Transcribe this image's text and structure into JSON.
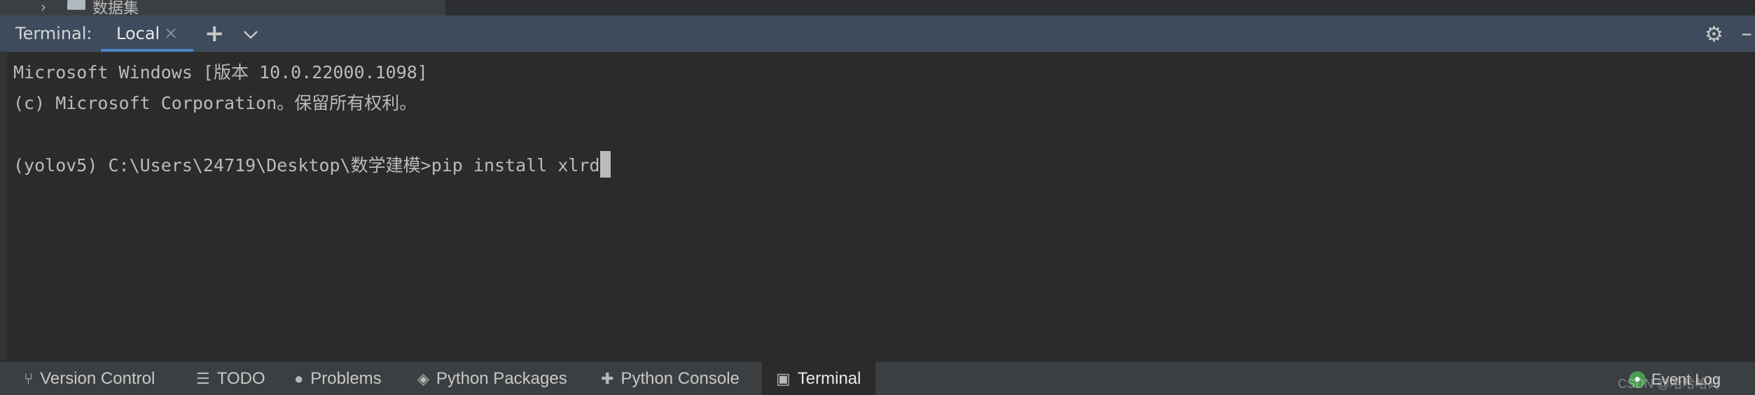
{
  "project_tree": {
    "folder_label": "数据集"
  },
  "terminal_header": {
    "title": "Terminal:",
    "tab_label": "Local",
    "tab_close": "×",
    "new_tab": "+",
    "options": "⌄",
    "gear": "⚙",
    "minimize": "–"
  },
  "terminal": {
    "line1": "Microsoft Windows [版本 10.0.22000.1098]",
    "line2": "(c) Microsoft Corporation。保留所有权利。",
    "prompt": "(yolov5) C:\\Users\\24719\\Desktop\\数学建模>",
    "command": "pip install xlrd"
  },
  "bottom_toolbar": {
    "items": [
      {
        "label": "Version Control",
        "icon": "branch-icon"
      },
      {
        "label": "TODO",
        "icon": "list-icon"
      },
      {
        "label": "Problems",
        "icon": "warning-icon"
      },
      {
        "label": "Python Packages",
        "icon": "layers-icon"
      },
      {
        "label": "Python Console",
        "icon": "python-icon"
      },
      {
        "label": "Terminal",
        "icon": "terminal-icon",
        "active": true
      }
    ],
    "event_log": "Event Log"
  },
  "watermark": "CSDN @哈哈哈码"
}
